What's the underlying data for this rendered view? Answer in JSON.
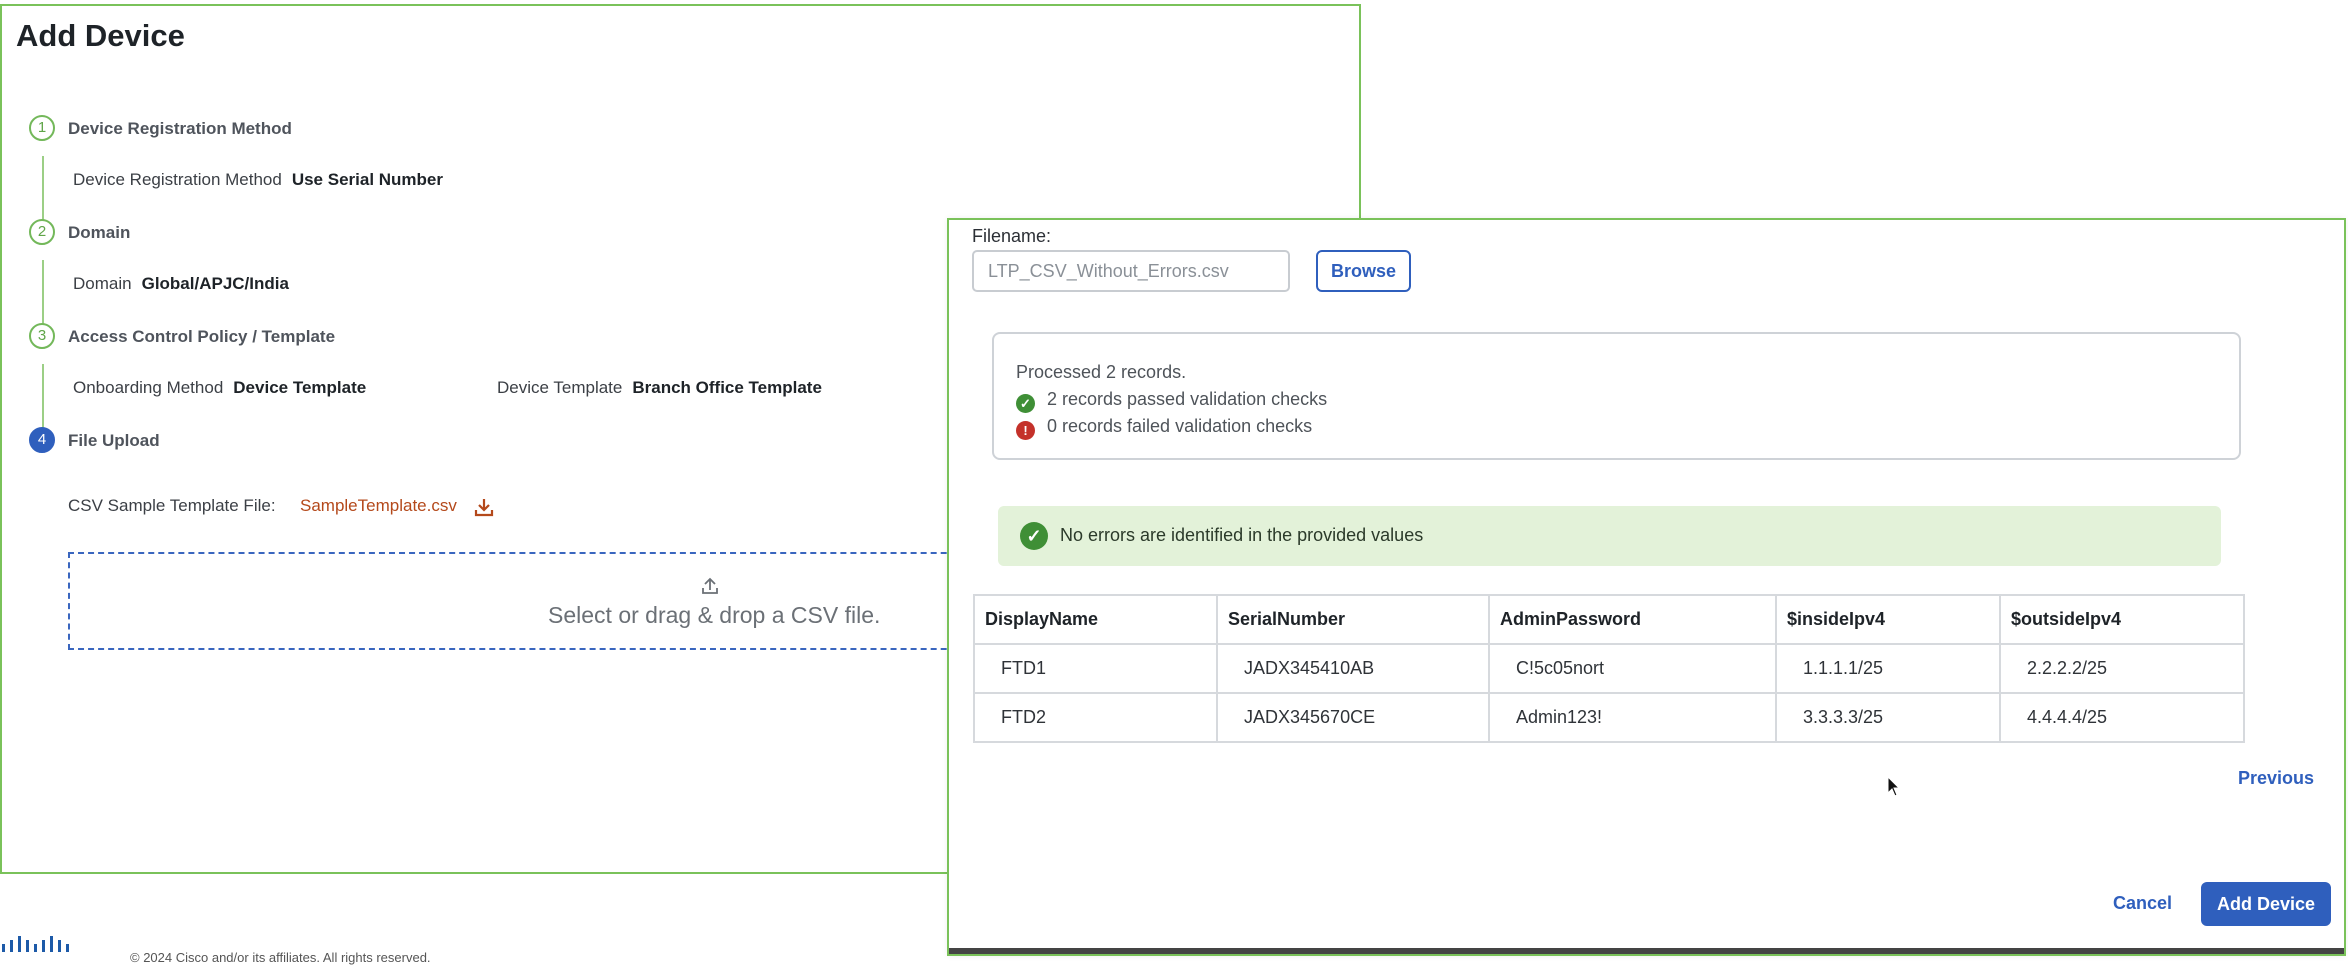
{
  "page": {
    "title": "Add Device"
  },
  "steps": [
    {
      "number": "1",
      "title": "Device Registration Method"
    },
    {
      "number": "2",
      "title": "Domain"
    },
    {
      "number": "3",
      "title": "Access Control Policy / Template"
    },
    {
      "number": "4",
      "title": "File Upload"
    }
  ],
  "step1": {
    "label": "Device Registration Method",
    "value": "Use Serial Number"
  },
  "step2": {
    "label": "Domain",
    "value": "Global/APJC/India"
  },
  "step3": {
    "onboarding_label": "Onboarding Method",
    "onboarding_value": "Device Template",
    "template_label": "Device Template",
    "template_value": "Branch Office Template"
  },
  "step4": {
    "sample_label": "CSV Sample Template File:",
    "sample_file": "SampleTemplate.csv",
    "dropzone_text": "Select or drag & drop a CSV file."
  },
  "footer": {
    "copyright": "© 2024 Cisco and/or its affiliates. All rights reserved."
  },
  "modal": {
    "filename_label": "Filename:",
    "filename_value": "LTP_CSV_Without_Errors.csv",
    "browse_label": "Browse",
    "summary": {
      "processed": "Processed 2 records.",
      "passed": "2 records passed validation checks",
      "failed": "0 records failed validation checks"
    },
    "banner_text": "No errors are identified in the provided values",
    "table": {
      "headers": [
        "DisplayName",
        "SerialNumber",
        "AdminPassword",
        "$insideIpv4",
        "$outsideIpv4"
      ],
      "rows": [
        [
          "FTD1",
          "JADX345410AB",
          "C!5c05nort",
          "1.1.1.1/25",
          "2.2.2.2/25"
        ],
        [
          "FTD2",
          "JADX345670CE",
          "Admin123!",
          "3.3.3.3/25",
          "4.4.4.4/25"
        ]
      ]
    },
    "previous_label": "Previous",
    "cancel_label": "Cancel",
    "add_device_label": "Add Device"
  },
  "colors": {
    "accent_blue": "#2f5fbd",
    "step_green": "#73b85a",
    "success_bg": "#e3f2d9",
    "error_red": "#c4312a",
    "link_orange": "#b4491b"
  }
}
